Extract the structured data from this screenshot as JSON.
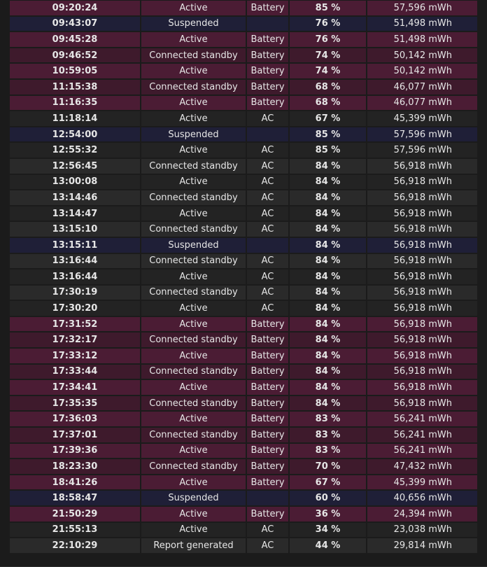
{
  "rows": [
    {
      "time": "09:20:24",
      "state": "Active",
      "source": "Battery",
      "percent": "85 %",
      "capacity": "57,596 mWh"
    },
    {
      "time": "09:43:07",
      "state": "Suspended",
      "source": "",
      "percent": "76 %",
      "capacity": "51,498 mWh"
    },
    {
      "time": "09:45:28",
      "state": "Active",
      "source": "Battery",
      "percent": "76 %",
      "capacity": "51,498 mWh"
    },
    {
      "time": "09:46:52",
      "state": "Connected standby",
      "source": "Battery",
      "percent": "74 %",
      "capacity": "50,142 mWh"
    },
    {
      "time": "10:59:05",
      "state": "Active",
      "source": "Battery",
      "percent": "74 %",
      "capacity": "50,142 mWh"
    },
    {
      "time": "11:15:38",
      "state": "Connected standby",
      "source": "Battery",
      "percent": "68 %",
      "capacity": "46,077 mWh"
    },
    {
      "time": "11:16:35",
      "state": "Active",
      "source": "Battery",
      "percent": "68 %",
      "capacity": "46,077 mWh"
    },
    {
      "time": "11:18:14",
      "state": "Active",
      "source": "AC",
      "percent": "67 %",
      "capacity": "45,399 mWh"
    },
    {
      "time": "12:54:00",
      "state": "Suspended",
      "source": "",
      "percent": "85 %",
      "capacity": "57,596 mWh"
    },
    {
      "time": "12:55:32",
      "state": "Active",
      "source": "AC",
      "percent": "85 %",
      "capacity": "57,596 mWh"
    },
    {
      "time": "12:56:45",
      "state": "Connected standby",
      "source": "AC",
      "percent": "84 %",
      "capacity": "56,918 mWh"
    },
    {
      "time": "13:00:08",
      "state": "Active",
      "source": "AC",
      "percent": "84 %",
      "capacity": "56,918 mWh"
    },
    {
      "time": "13:14:46",
      "state": "Connected standby",
      "source": "AC",
      "percent": "84 %",
      "capacity": "56,918 mWh"
    },
    {
      "time": "13:14:47",
      "state": "Active",
      "source": "AC",
      "percent": "84 %",
      "capacity": "56,918 mWh"
    },
    {
      "time": "13:15:10",
      "state": "Connected standby",
      "source": "AC",
      "percent": "84 %",
      "capacity": "56,918 mWh"
    },
    {
      "time": "13:15:11",
      "state": "Suspended",
      "source": "",
      "percent": "84 %",
      "capacity": "56,918 mWh"
    },
    {
      "time": "13:16:44",
      "state": "Connected standby",
      "source": "AC",
      "percent": "84 %",
      "capacity": "56,918 mWh"
    },
    {
      "time": "13:16:44",
      "state": "Active",
      "source": "AC",
      "percent": "84 %",
      "capacity": "56,918 mWh"
    },
    {
      "time": "17:30:19",
      "state": "Connected standby",
      "source": "AC",
      "percent": "84 %",
      "capacity": "56,918 mWh"
    },
    {
      "time": "17:30:20",
      "state": "Active",
      "source": "AC",
      "percent": "84 %",
      "capacity": "56,918 mWh"
    },
    {
      "time": "17:31:52",
      "state": "Active",
      "source": "Battery",
      "percent": "84 %",
      "capacity": "56,918 mWh"
    },
    {
      "time": "17:32:17",
      "state": "Connected standby",
      "source": "Battery",
      "percent": "84 %",
      "capacity": "56,918 mWh"
    },
    {
      "time": "17:33:12",
      "state": "Active",
      "source": "Battery",
      "percent": "84 %",
      "capacity": "56,918 mWh"
    },
    {
      "time": "17:33:44",
      "state": "Connected standby",
      "source": "Battery",
      "percent": "84 %",
      "capacity": "56,918 mWh"
    },
    {
      "time": "17:34:41",
      "state": "Active",
      "source": "Battery",
      "percent": "84 %",
      "capacity": "56,918 mWh"
    },
    {
      "time": "17:35:35",
      "state": "Connected standby",
      "source": "Battery",
      "percent": "84 %",
      "capacity": "56,918 mWh"
    },
    {
      "time": "17:36:03",
      "state": "Active",
      "source": "Battery",
      "percent": "83 %",
      "capacity": "56,241 mWh"
    },
    {
      "time": "17:37:01",
      "state": "Connected standby",
      "source": "Battery",
      "percent": "83 %",
      "capacity": "56,241 mWh"
    },
    {
      "time": "17:39:36",
      "state": "Active",
      "source": "Battery",
      "percent": "83 %",
      "capacity": "56,241 mWh"
    },
    {
      "time": "18:23:30",
      "state": "Connected standby",
      "source": "Battery",
      "percent": "70 %",
      "capacity": "47,432 mWh"
    },
    {
      "time": "18:41:26",
      "state": "Active",
      "source": "Battery",
      "percent": "67 %",
      "capacity": "45,399 mWh"
    },
    {
      "time": "18:58:47",
      "state": "Suspended",
      "source": "",
      "percent": "60 %",
      "capacity": "40,656 mWh"
    },
    {
      "time": "21:50:29",
      "state": "Active",
      "source": "Battery",
      "percent": "36 %",
      "capacity": "24,394 mWh"
    },
    {
      "time": "21:55:13",
      "state": "Active",
      "source": "AC",
      "percent": "34 %",
      "capacity": "23,038 mWh"
    },
    {
      "time": "22:10:29",
      "state": "Report generated",
      "source": "AC",
      "percent": "44 %",
      "capacity": "29,814 mWh"
    }
  ],
  "colors": {
    "background": "#1b1b1b",
    "battery_row": "#4b1c34",
    "battery_row_alt": "#3e1a2c",
    "ac_row": "#2a2a2a",
    "ac_row_alt": "#232323",
    "suspended_row": "#1f1f37",
    "text": "#e6e6e6"
  }
}
